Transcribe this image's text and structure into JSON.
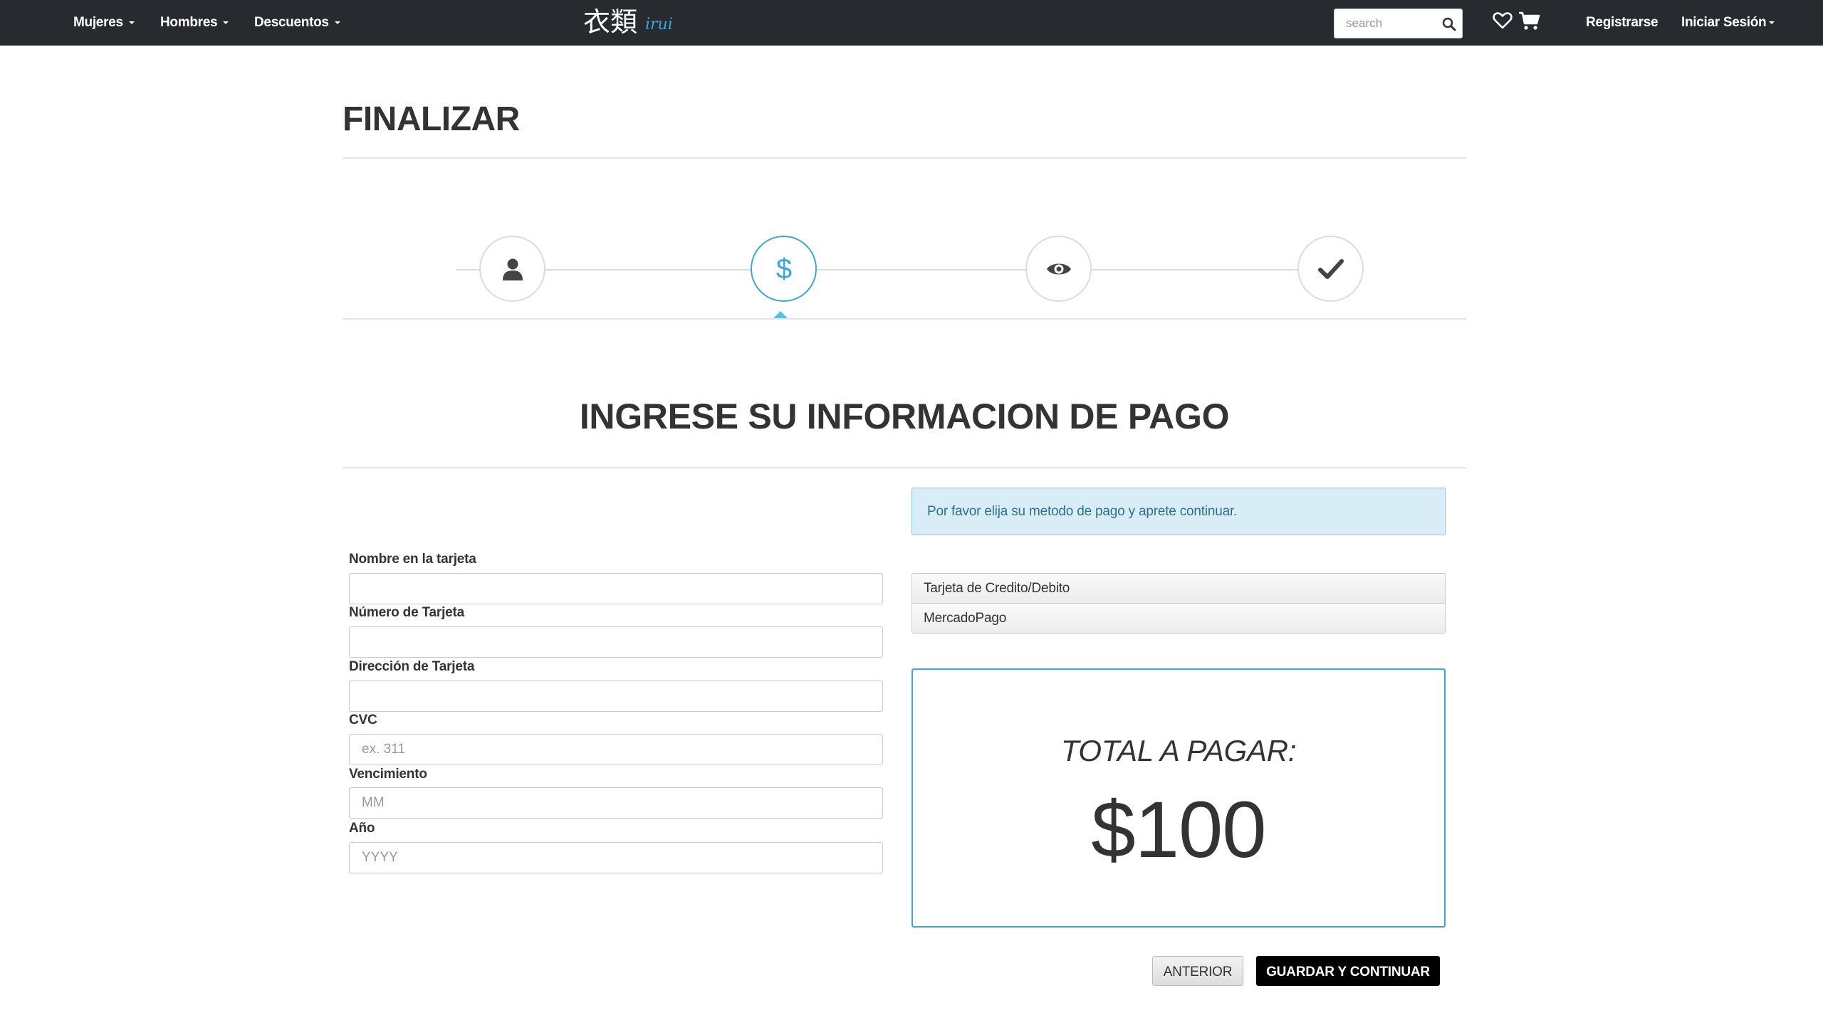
{
  "navbar": {
    "menu": [
      {
        "label": "Mujeres"
      },
      {
        "label": "Hombres"
      },
      {
        "label": "Descuentos"
      }
    ],
    "logo_text": "衣類",
    "logo_subtext": "irui",
    "search_placeholder": "search",
    "register_label": "Registrarse",
    "login_label": "Iniciar Sesión",
    "icons": [
      "search-icon",
      "heart-icon",
      "cart-icon"
    ]
  },
  "page": {
    "title": "FINALIZAR",
    "section_title": "INGRESE SU INFORMACION DE PAGO"
  },
  "wizard": {
    "steps": [
      {
        "icon": "user-icon",
        "active": false
      },
      {
        "icon": "dollar-icon",
        "active": true
      },
      {
        "icon": "eye-icon",
        "active": false
      },
      {
        "icon": "check-icon",
        "active": false
      }
    ],
    "active_color": "#3fa7d6"
  },
  "form": {
    "fields": [
      {
        "label": "Nombre en la tarjeta",
        "value": "",
        "placeholder": ""
      },
      {
        "label": "Número de Tarjeta",
        "value": "",
        "placeholder": ""
      },
      {
        "label": "Dirección de Tarjeta",
        "value": "",
        "placeholder": ""
      },
      {
        "label": "CVC",
        "value": "",
        "placeholder": "ex. 311"
      },
      {
        "label": "Vencimiento",
        "value": "",
        "placeholder": "MM"
      },
      {
        "label": "Año",
        "value": "",
        "placeholder": "YYYY"
      }
    ]
  },
  "payment": {
    "alert": "Por favor elija su metodo de pago y aprete continuar.",
    "methods": [
      "Tarjeta de Credito/Debito",
      "MercadoPago"
    ],
    "total_label": "TOTAL A PAGAR:",
    "total_amount": "$100"
  },
  "buttons": {
    "previous": "ANTERIOR",
    "save_continue": "GUARDAR Y CONTINUAR"
  },
  "colors": {
    "navbar_bg": "#272b30",
    "accent": "#3fa7d6",
    "alert_bg": "#d9edf7",
    "primary_button": "#000000"
  }
}
